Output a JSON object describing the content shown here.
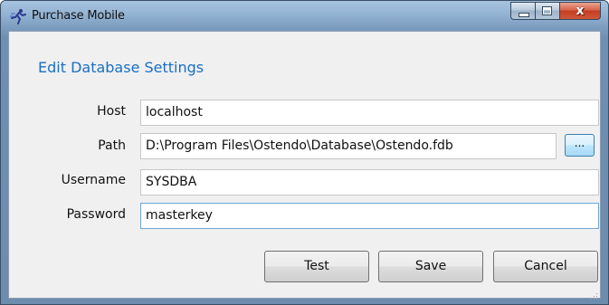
{
  "window": {
    "title": "Purchase Mobile",
    "close_glyph": "x"
  },
  "form": {
    "heading": "Edit Database Settings",
    "host": {
      "label": "Host",
      "value": "localhost"
    },
    "path": {
      "label": "Path",
      "value": "D:\\Program Files\\Ostendo\\Database\\Ostendo.fdb",
      "browse_label": "..."
    },
    "username": {
      "label": "Username",
      "value": "SYSDBA"
    },
    "password": {
      "label": "Password",
      "value": "masterkey"
    }
  },
  "buttons": {
    "test": "Test",
    "save": "Save",
    "cancel": "Cancel"
  },
  "icons": {
    "app": "runner-icon",
    "minimize": "minimize-icon",
    "maximize": "maximize-icon",
    "close": "close-icon",
    "resize": "resize-grip-icon"
  },
  "colors": {
    "heading": "#1a6fc4",
    "close_button": "#c33d22",
    "focus_border": "#6fa6d9"
  }
}
